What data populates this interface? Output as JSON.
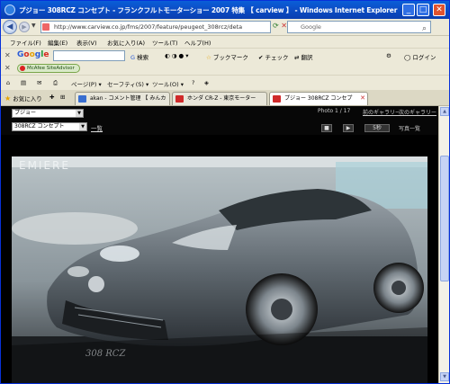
{
  "window": {
    "title": "プジョー 308RCZ コンセプト - フランクフルトモーターショー 2007 特集 【 carview 】 - Windows Internet Explorer",
    "min": "_",
    "max": "□",
    "close": "✕"
  },
  "address_bar": {
    "url": "http://www.carview.co.jp/fms/2007/feature/peugeot_308rcz/deta",
    "search_text": "Google"
  },
  "menu": [
    "ファイル(F)",
    "編集(E)",
    "表示(V)",
    "お気に入り(A)",
    "ツール(T)",
    "ヘルプ(H)"
  ],
  "google_toolbar": {
    "logo": [
      "G",
      "o",
      "o",
      "g",
      "l",
      "e"
    ],
    "search_label": "検索",
    "bookmark": "ブックマーク",
    "check": "チェック",
    "translate": "翻訳",
    "login": "ログイン"
  },
  "mcafee": {
    "label": "McAfee SiteAdvisor"
  },
  "command_bar": {
    "page": "ページ(P)",
    "safety": "セーフティ(S)",
    "tools": "ツール(O)"
  },
  "tabs": {
    "favorites": "お気に入り",
    "items": [
      {
        "label": "akan - コメント管理 【 みんカ",
        "color": "#3a6fd0"
      },
      {
        "label": "ホンダ CR-Z - 東京モーター",
        "color": "#d02a2a"
      },
      {
        "label": "プジョー 308RCZ コンセプ",
        "color": "#d02a2a"
      }
    ]
  },
  "viewer": {
    "maker_select": "プジョー",
    "model_select": "308RCZ コンセプト",
    "list_link": "一覧",
    "photo_count": "Photo 1 / 17",
    "link_prev_gallery": "前のギャラリー",
    "link_next_gallery": "次のギャラリー",
    "play_label": "▶",
    "stop_label": "■",
    "interval": "5秒",
    "photo_list": "写真一覧",
    "photo_caption": "308 RCZ",
    "backdrop_text": "EMIERE"
  }
}
